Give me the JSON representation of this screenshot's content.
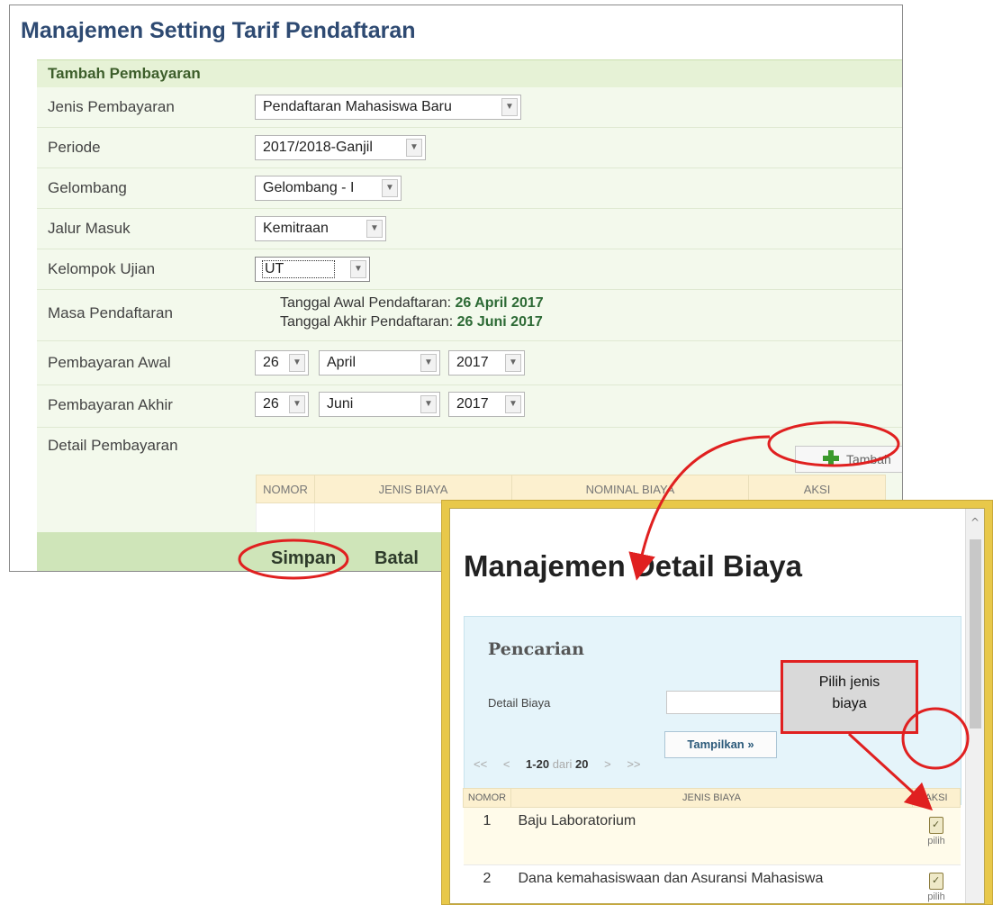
{
  "main": {
    "title": "Manajemen Setting Tarif Pendaftaran",
    "section_header": "Tambah Pembayaran",
    "fields": {
      "jenis_pembayaran": {
        "label": "Jenis Pembayaran",
        "value": "Pendaftaran Mahasiswa Baru"
      },
      "periode": {
        "label": "Periode",
        "value": "2017/2018-Ganjil"
      },
      "gelombang": {
        "label": "Gelombang",
        "value": "Gelombang - I"
      },
      "jalur_masuk": {
        "label": "Jalur Masuk",
        "value": "Kemitraan"
      },
      "kelompok_ujian": {
        "label": "Kelompok Ujian",
        "value": "UT"
      },
      "masa_pendaftaran": {
        "label": "Masa Pendaftaran",
        "awal_prefix": "Tanggal Awal Pendaftaran:",
        "awal_value": "26 April 2017",
        "akhir_prefix": "Tanggal Akhir Pendaftaran:",
        "akhir_value": "26 Juni 2017"
      },
      "pembayaran_awal": {
        "label": "Pembayaran Awal",
        "day": "26",
        "month": "April",
        "year": "2017"
      },
      "pembayaran_akhir": {
        "label": "Pembayaran Akhir",
        "day": "26",
        "month": "Juni",
        "year": "2017"
      },
      "detail_pembayaran": {
        "label": "Detail Pembayaran"
      }
    },
    "tambah_label": "Tambah",
    "detail_table": {
      "columns": [
        "NOMOR",
        "JENIS BIAYA",
        "NOMINAL BIAYA",
        "AKSI"
      ]
    },
    "footer": {
      "simpan": "Simpan",
      "batal": "Batal"
    }
  },
  "popup": {
    "title": "Manajemen Detail Biaya",
    "search": {
      "title": "Pencarian",
      "label": "Detail Biaya",
      "input_value": "",
      "button": "Tampilkan »"
    },
    "pager": {
      "first": "<<",
      "prev": "<",
      "range": "1-20",
      "of": "dari",
      "total": "20",
      "next": ">",
      "last": ">>"
    },
    "table": {
      "columns": [
        "NOMOR",
        "JENIS BIAYA",
        "AKSI"
      ],
      "rows": [
        {
          "no": "1",
          "jenis": "Baju Laboratorium",
          "aksi": "pilih"
        },
        {
          "no": "2",
          "jenis": "Dana kemahasiswaan dan Asuransi Mahasiswa",
          "aksi": "pilih"
        }
      ]
    },
    "scroll_up": "^"
  },
  "callout": {
    "line1": "Pilih jenis",
    "line2": "biaya"
  },
  "colors": {
    "annotation_red": "#e02020",
    "title_blue": "#2e4a72",
    "form_green": "#e6f2d6",
    "popup_border": "#e8c84a"
  }
}
